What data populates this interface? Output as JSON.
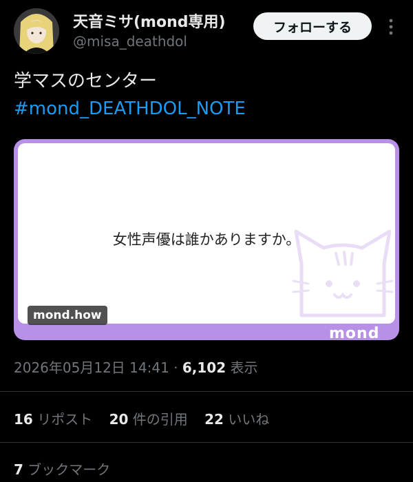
{
  "user": {
    "display_name": "天音ミサ(mond専用)",
    "handle": "@misa_deathdol"
  },
  "header": {
    "follow_label": "フォローする"
  },
  "tweet": {
    "text": "学マスのセンター",
    "hashtag": "#mond_DEATHDOL_NOTE"
  },
  "card": {
    "question": "女性声優は誰かありますか。",
    "domain_badge": "mond.how",
    "brand_logo": "mond",
    "accent_color": "#b990e8"
  },
  "meta": {
    "datetime": "2026年05月12日 14:41",
    "separator": "·",
    "views_count": "6,102",
    "views_label": "表示"
  },
  "stats": {
    "reposts_count": "16",
    "reposts_label": "リポスト",
    "quotes_count": "20",
    "quotes_label": "件の引用",
    "likes_count": "22",
    "likes_label": "いいね"
  },
  "bookmarks": {
    "count": "7",
    "label": "ブックマーク"
  },
  "colors": {
    "link": "#1d9bf0",
    "muted": "#71767b",
    "background": "#000000"
  }
}
